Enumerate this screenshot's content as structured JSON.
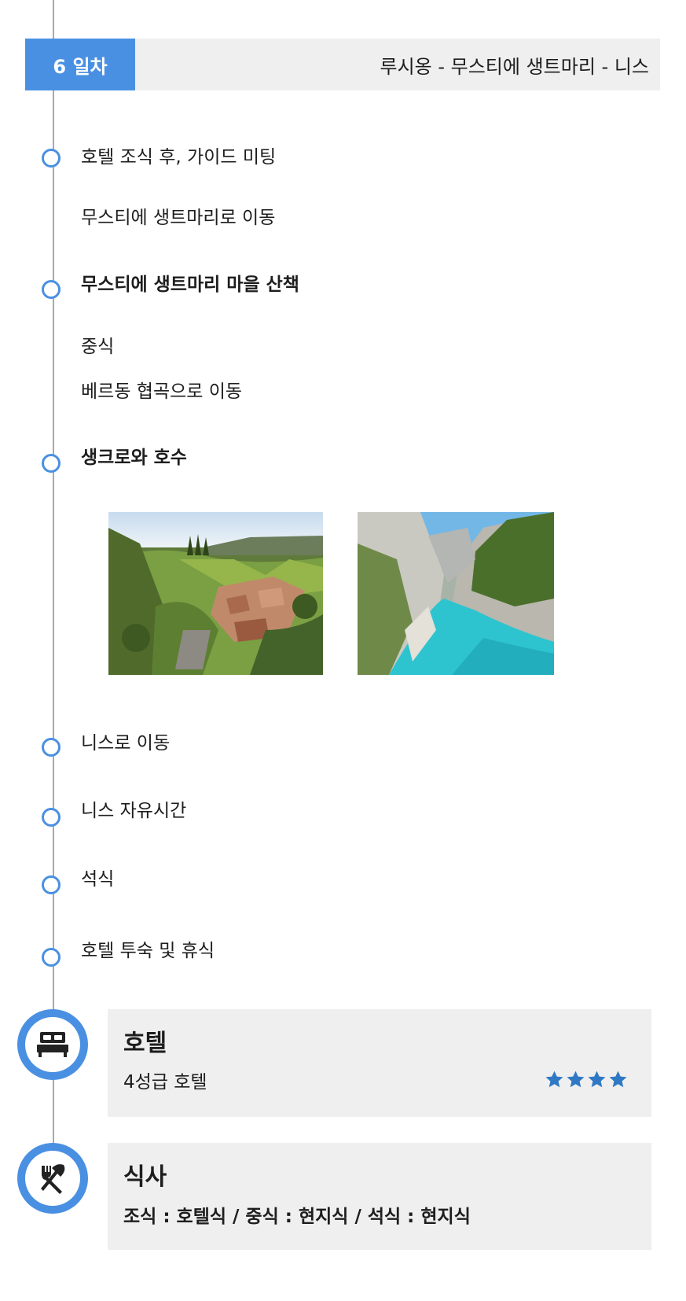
{
  "day": {
    "badge": "6 일차",
    "route": "루시옹 - 무스티에 생트마리 - 니스"
  },
  "schedule": [
    {
      "text": "호텔 조식 후, 가이드 미팅",
      "bold": false,
      "marker": true
    },
    {
      "text": "무스티에 생트마리로 이동",
      "bold": false,
      "marker": false
    },
    {
      "text": "무스티에 생트마리 마을 산책",
      "bold": true,
      "marker": true
    },
    {
      "text": "중식",
      "bold": false,
      "marker": false
    },
    {
      "text": "베르동 협곡으로 이동",
      "bold": false,
      "marker": false
    },
    {
      "text": "생크로와 호수",
      "bold": true,
      "marker": true
    },
    {
      "text": "니스로 이동",
      "bold": false,
      "marker": true
    },
    {
      "text": "니스 자유시간",
      "bold": false,
      "marker": true
    },
    {
      "text": "석식",
      "bold": false,
      "marker": true
    },
    {
      "text": "호텔 투숙 및 휴식",
      "bold": false,
      "marker": true
    }
  ],
  "photos": [
    {
      "subject": "village-hillside-photo"
    },
    {
      "subject": "canyon-lake-photo"
    }
  ],
  "hotel": {
    "title": "호텔",
    "grade": "4성급 호텔",
    "rating": 4,
    "icon": "bed-icon"
  },
  "meal": {
    "title": "식사",
    "detail": "조식 : 호텔식 / 중식 : 현지식 / 석식 : 현지식",
    "icon": "fork-knife-icon"
  },
  "colors": {
    "accent": "#4a90e2",
    "star": "#2f78c4",
    "panel": "#efefef",
    "line": "#a9a9a9"
  }
}
